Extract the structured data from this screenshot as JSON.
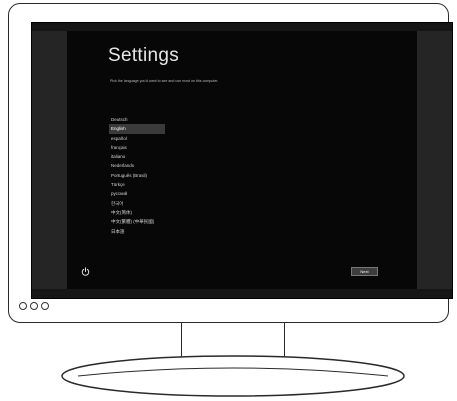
{
  "screen": {
    "title": "Settings",
    "subtitle": "Pick the language you'd want to see and use most on this computer.",
    "languages": [
      "Deutsch",
      "English",
      "español",
      "français",
      "italiano",
      "Nederlands",
      "Português (Brasil)",
      "Türkçe",
      "русский",
      "한국어",
      "中文(简体)",
      "中文(繁體) (中華民國)",
      "日本語"
    ],
    "selected_language": "English",
    "next_label": "Next",
    "power_icon": "power-icon"
  },
  "monitor": {
    "indicator_lights": 3
  },
  "colors": {
    "screen_bg": "#070707",
    "panel_bg": "#252525",
    "selected_bg": "#3a3a3a",
    "text": "#e6e6e6"
  }
}
